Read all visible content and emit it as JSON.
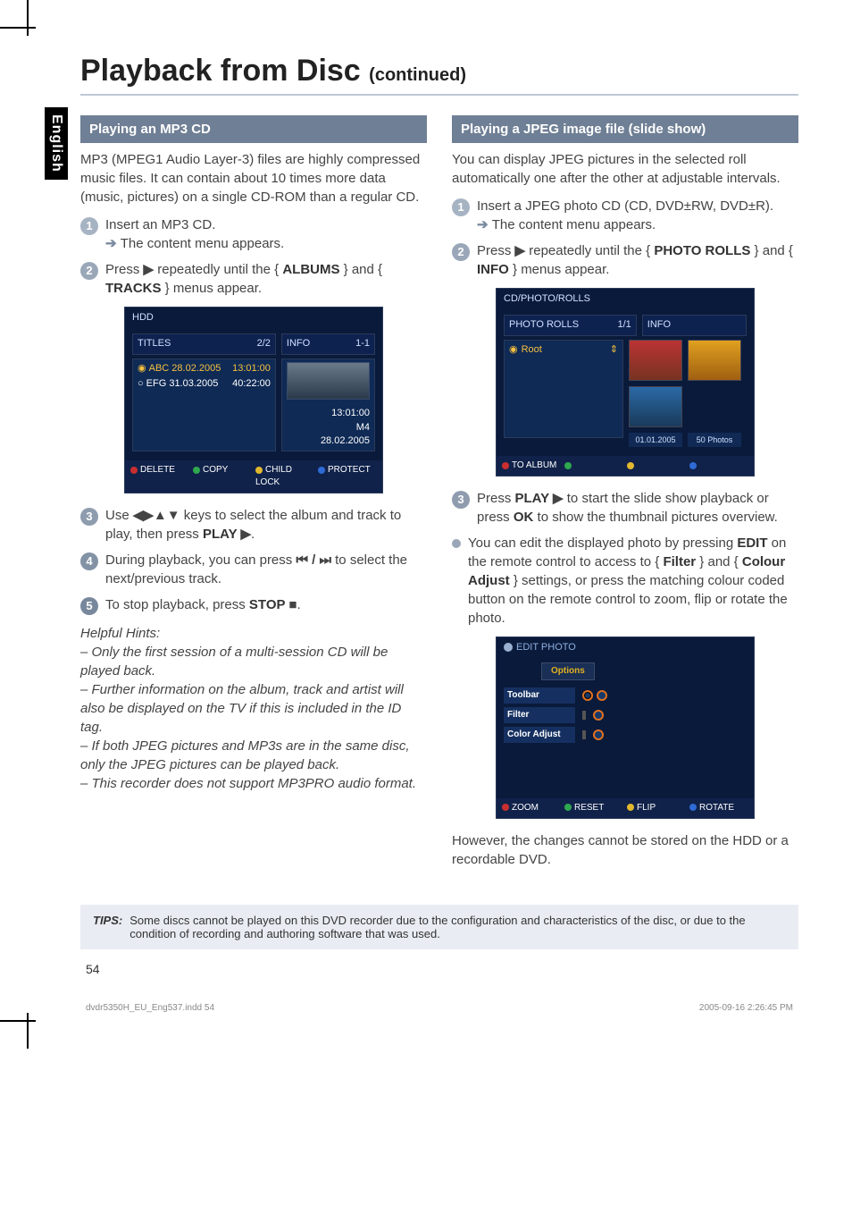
{
  "side_tab": "English",
  "title_main": "Playback from Disc ",
  "title_cont": "(continued)",
  "left": {
    "hdr": "Playing an MP3 CD",
    "intro": "MP3 (MPEG1 Audio Layer-3) files are highly compressed music files. It can contain about 10 times more data (music, pictures) on a single CD-ROM than a regular CD.",
    "s1": "Insert an MP3 CD.",
    "s1r": "The content menu appears.",
    "s2a": "Press ",
    "s2b": " repeatedly until the { ",
    "s2c": "ALBUMS",
    "s2d": " } and { ",
    "s2e": "TRACKS",
    "s2f": " } menus appear.",
    "s3a": "Use ",
    "s3b": " keys to select the album and track to play, then press ",
    "s3c": "PLAY ",
    "s3d": ".",
    "s4a": "During playback, you can press ",
    "s4b": " to select the next/previous track.",
    "s5a": "To stop playback, press ",
    "s5b": "STOP ",
    "s5c": ".",
    "hints_title": "Helpful Hints:",
    "h1": "–  Only the first session of a multi-session CD will be played back.",
    "h2": "–  Further information on the album, track and artist will also be displayed on the TV if this is included in the ID tag.",
    "h3": "–  If both JPEG pictures and MP3s are in the same disc, only the JPEG pictures can be played back.",
    "h4": "–  This recorder does not support MP3PRO audio format.",
    "ss": {
      "top": "HDD",
      "titles_label": "TITLES",
      "titles_count": "2/2",
      "info_label": "INFO",
      "page": "1-1",
      "row1_name": "ABC 28.02.2005",
      "row1_time": "13:01:00",
      "row2_name": "EFG 31.03.2005",
      "row2_time": "40:22:00",
      "info_time": "13:01:00",
      "info_ch": "M4",
      "info_date": "28.02.2005",
      "foot_delete": "DELETE",
      "foot_copy": "COPY",
      "foot_cl": "CHILD LOCK",
      "foot_prot": "PROTECT"
    }
  },
  "right": {
    "hdr": "Playing a JPEG image file (slide show)",
    "intro": "You can display JPEG pictures in the selected roll automatically one after the other at adjustable intervals.",
    "s1": "Insert a JPEG photo CD (CD, DVD±RW, DVD±R).",
    "s1r": "The content menu appears.",
    "s2a": "Press ",
    "s2b": " repeatedly until the { ",
    "s2c": "PHOTO ROLLS",
    "s2d": " } and { ",
    "s2e": "INFO",
    "s2f": " } menus appear.",
    "s3a": "Press ",
    "s3b": "PLAY ",
    "s3c": " to start the slide show playback or press ",
    "s3d": "OK",
    "s3e": " to show the thumbnail pictures overview.",
    "bul_a": "You can edit the displayed photo by pressing ",
    "bul_b": "EDIT",
    "bul_c": " on the remote control to access to { ",
    "bul_d": "Filter",
    "bul_e": " } and { ",
    "bul_f": "Colour Adjust",
    "bul_g": " } settings, or press the matching colour coded button on the remote control to zoom, flip or rotate the photo.",
    "tail": "However, the changes cannot be stored on the HDD or a recordable DVD.",
    "ss": {
      "top": "CD/PHOTO/ROLLS",
      "pr_label": "PHOTO ROLLS",
      "pr_count": "1/1",
      "info_label": "INFO",
      "root": "Root",
      "date": "01.01.2005",
      "count": "50 Photos",
      "foot_toalbum": "TO ALBUM"
    },
    "ss2": {
      "top": "EDIT PHOTO",
      "options": "Options",
      "toolbar": "Toolbar",
      "filter": "Filter",
      "coloradj": "Color Adjust",
      "zoom": "ZOOM",
      "reset": "RESET",
      "flip": "FLIP",
      "rotate": "ROTATE"
    }
  },
  "tips_label": "TIPS:",
  "tips_body": "Some discs cannot be played on this DVD recorder due to the configuration and characteristics of the disc, or due to the condition of recording and authoring software that was used.",
  "page_number": "54",
  "footer_file": "dvdr5350H_EU_Eng537.indd   54",
  "footer_time": "2005-09-16   2:26:45 PM"
}
